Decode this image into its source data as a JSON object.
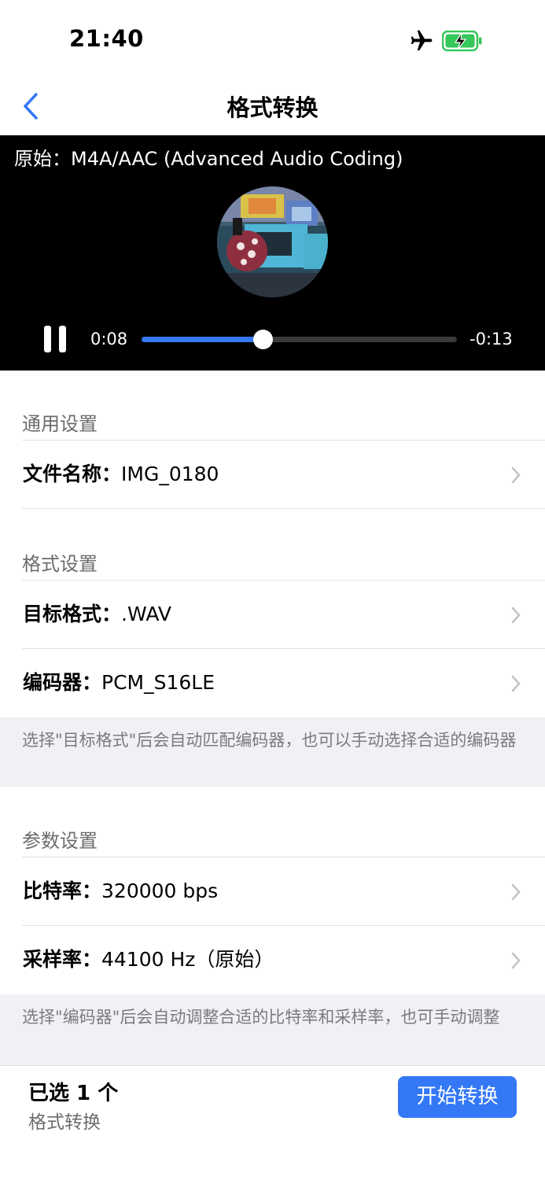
{
  "status_bar": {
    "time": "21:40",
    "icons": [
      "airplane-icon",
      "battery-charging-icon"
    ],
    "battery_color": "#34c759"
  },
  "nav": {
    "title": "格式转换",
    "back_icon": "chevron-left-icon"
  },
  "player": {
    "original_format": "原始：M4A/AAC (Advanced Audio Coding)",
    "elapsed": "0:08",
    "remaining": "-0:13",
    "progress_fraction": 0.385,
    "accent_color": "#3478f6"
  },
  "sections": {
    "general": {
      "header": "通用设置",
      "file_name_label": "文件名称：",
      "file_name_value": "IMG_0180"
    },
    "format": {
      "header": "格式设置",
      "target_label": "目标格式：",
      "target_value": ".WAV",
      "encoder_label": "编码器：",
      "encoder_value": "PCM_S16LE",
      "note": "选择\"目标格式\"后会自动匹配编码器，也可以手动选择合适的编码器"
    },
    "params": {
      "header": "参数设置",
      "bitrate_label": "比特率：",
      "bitrate_value": "320000 bps",
      "samplerate_label": "采样率：",
      "samplerate_value": "44100 Hz（原始）",
      "note": "选择\"编码器\"后会自动调整合适的比特率和采样率，也可手动调整"
    }
  },
  "bottom": {
    "selected": "已选 1 个",
    "subtitle": "格式转换",
    "start_button": "开始转换"
  }
}
